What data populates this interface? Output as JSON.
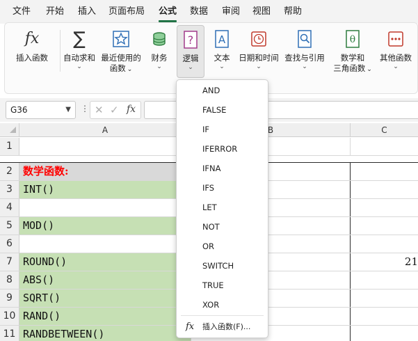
{
  "menu_tabs": [
    "文件",
    "开始",
    "插入",
    "页面布局",
    "公式",
    "数据",
    "审阅",
    "视图",
    "帮助"
  ],
  "active_tab": "公式",
  "ribbon": {
    "insert_function": "插入函数",
    "autosum": "自动求和",
    "recent": [
      "最近使用的",
      "函数"
    ],
    "financial": "财务",
    "logical": "逻辑",
    "text": "文本",
    "datetime": "日期和时间",
    "lookup": "查找与引用",
    "math": [
      "数学和",
      "三角函数"
    ],
    "more": "其他函数",
    "chevron": "⌄"
  },
  "formula_bar": {
    "name_box": "G36",
    "more_glyph": "⋮",
    "fx_glyph": "fx"
  },
  "columns": [
    "A",
    "B",
    "C"
  ],
  "rows": [
    {
      "num": "1",
      "a": "",
      "c": ""
    },
    {
      "num": "2",
      "a": "数学函数:",
      "c": ""
    },
    {
      "num": "3",
      "a": "INT()",
      "c": ""
    },
    {
      "num": "4",
      "a": "",
      "c": ""
    },
    {
      "num": "5",
      "a": "MOD()",
      "c": ""
    },
    {
      "num": "6",
      "a": "",
      "c": ""
    },
    {
      "num": "7",
      "a": "ROUND()",
      "c": "21"
    },
    {
      "num": "8",
      "a": "ABS()",
      "c": ""
    },
    {
      "num": "9",
      "a": "SQRT()",
      "c": ""
    },
    {
      "num": "10",
      "a": "RAND()",
      "c": ""
    },
    {
      "num": "11",
      "a": "RANDBETWEEN()",
      "c": ""
    }
  ],
  "dropdown": {
    "items": [
      "AND",
      "FALSE",
      "IF",
      "IFERROR",
      "IFNA",
      "IFS",
      "LET",
      "NOT",
      "OR",
      "SWITCH",
      "TRUE",
      "XOR"
    ],
    "insert_label": "插入函数(F)...",
    "insert_glyph": "fx"
  },
  "colors": {
    "accent": "#217346",
    "green_fill": "#c6e0b4",
    "header_fill": "#d9d9d9",
    "header_text": "#ff0000"
  }
}
